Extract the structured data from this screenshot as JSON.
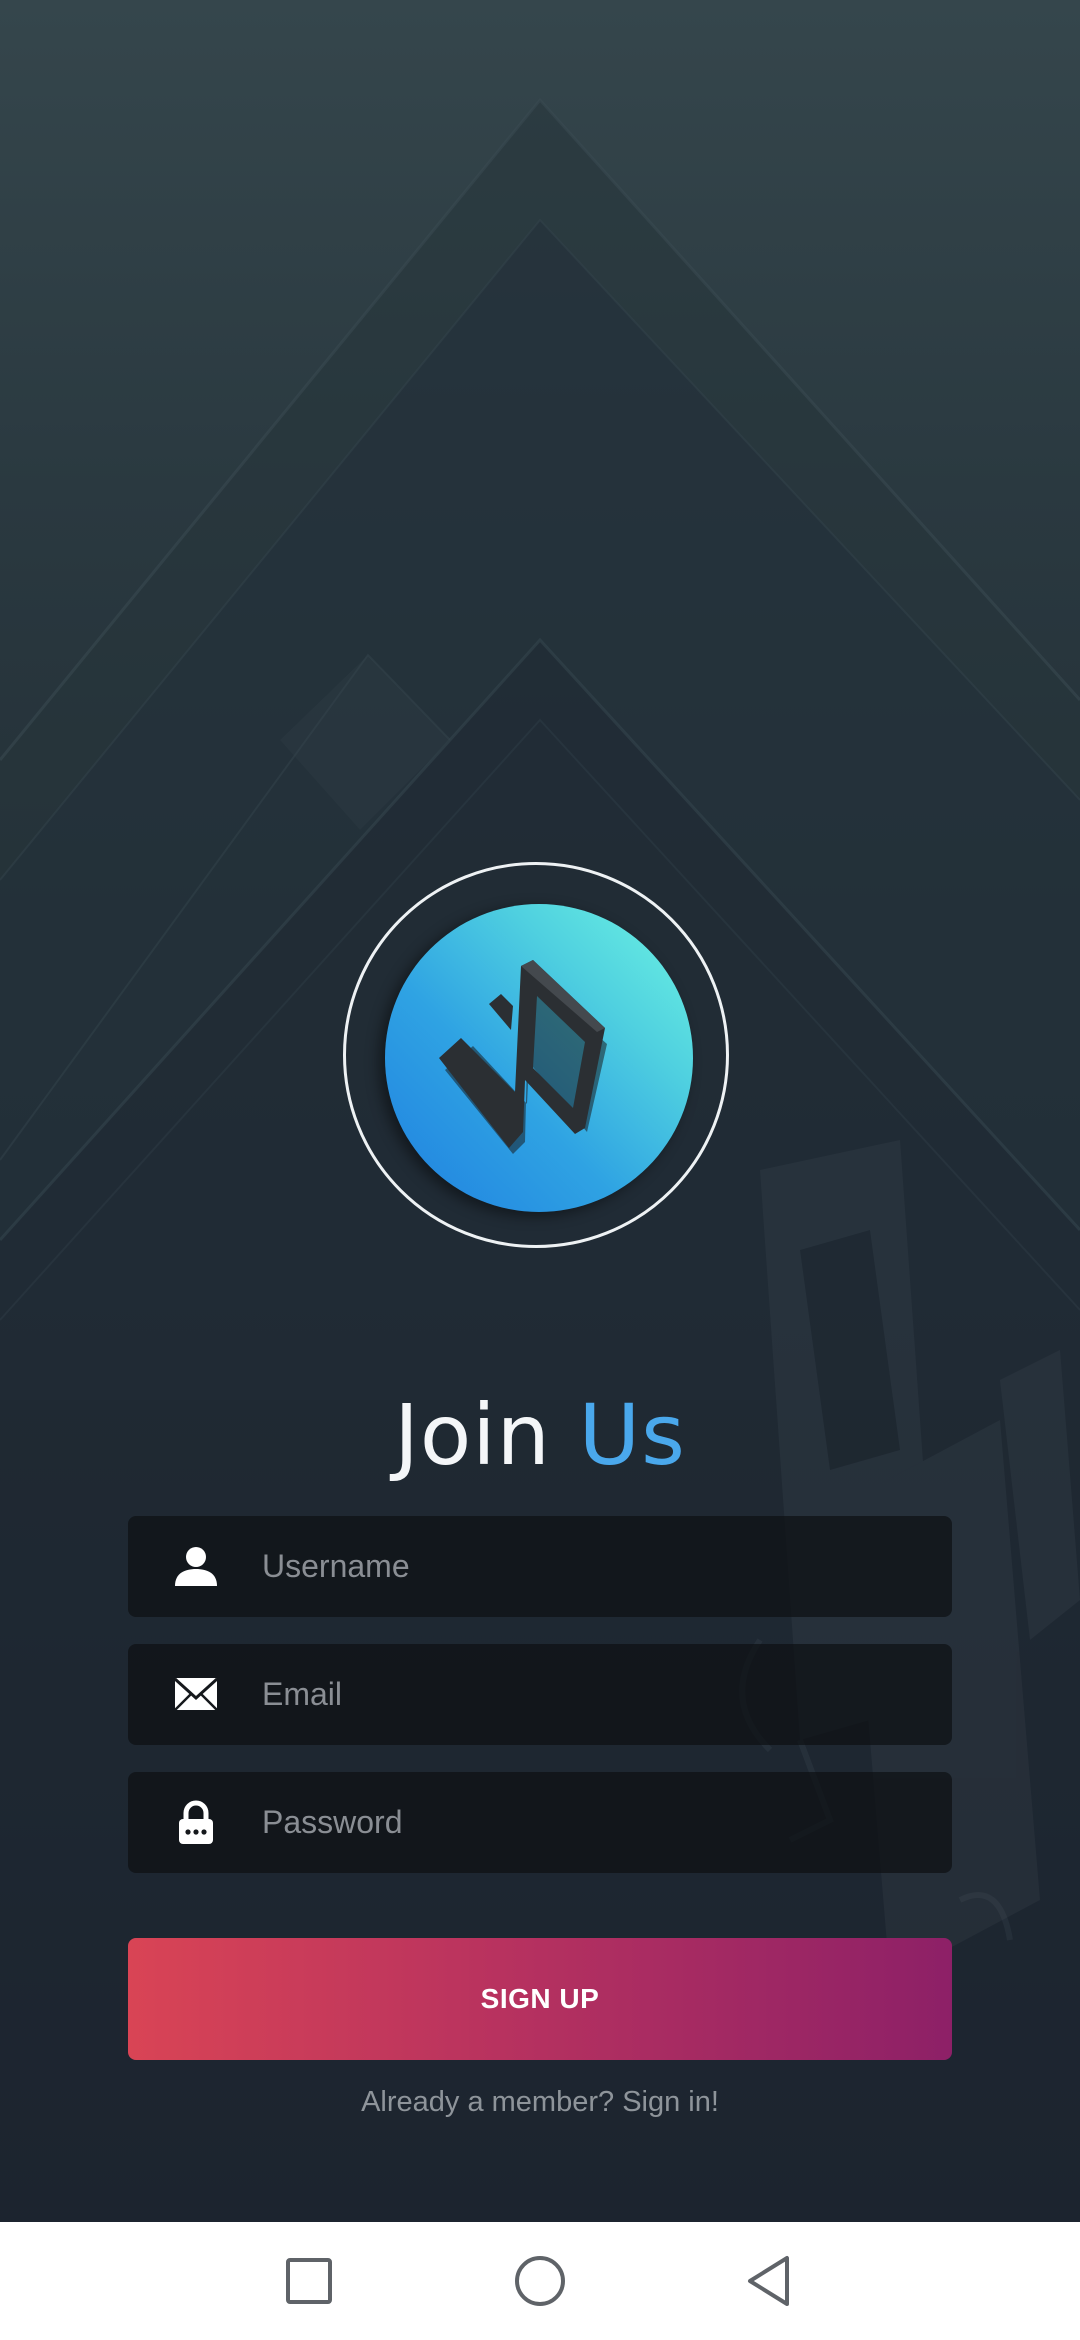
{
  "logo": {
    "icon": "app-logo-icon",
    "colors": {
      "gradient_start": "#1f7fe0",
      "gradient_end": "#6ef5e2",
      "mark": "#2b2f33"
    }
  },
  "title": {
    "first": "Join",
    "second": "Us",
    "first_color": "#f4f6f8",
    "second_color": "#4aa8ec"
  },
  "form": {
    "username": {
      "placeholder": "Username",
      "value": "",
      "icon": "user-icon"
    },
    "email": {
      "placeholder": "Email",
      "value": "",
      "icon": "envelope-icon"
    },
    "password": {
      "placeholder": "Password",
      "value": "",
      "icon": "lock-icon"
    }
  },
  "signup_button": {
    "label": "SIGN UP",
    "gradient": [
      "#d94455",
      "#8d2067"
    ]
  },
  "signin_link": {
    "text": "Already a member? Sign in!"
  },
  "navbar": {
    "buttons": [
      "recents-icon",
      "home-icon",
      "back-icon"
    ]
  }
}
